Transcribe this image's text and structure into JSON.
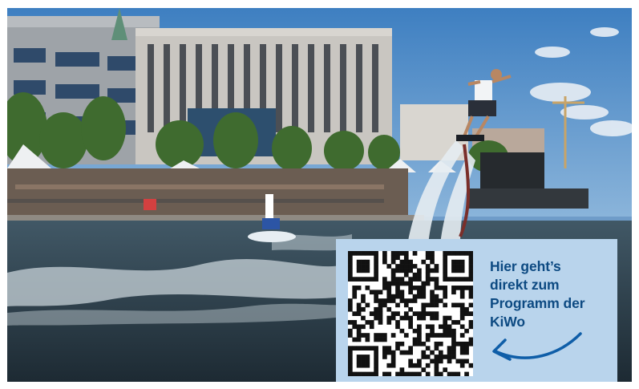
{
  "promo": {
    "caption_lines": [
      "Hier geht’s",
      "direkt zum",
      "Programm der",
      "KiWo"
    ],
    "panel_color": "#b9d4ec",
    "text_color": "#0d4a82",
    "arrow_color": "#0f5ea8"
  },
  "qr": {
    "size": 29,
    "seed": 20230617
  },
  "photo": {
    "scene": "harbour-event-water-show",
    "icons": [
      "qr-code",
      "curved-arrow-icon"
    ]
  }
}
